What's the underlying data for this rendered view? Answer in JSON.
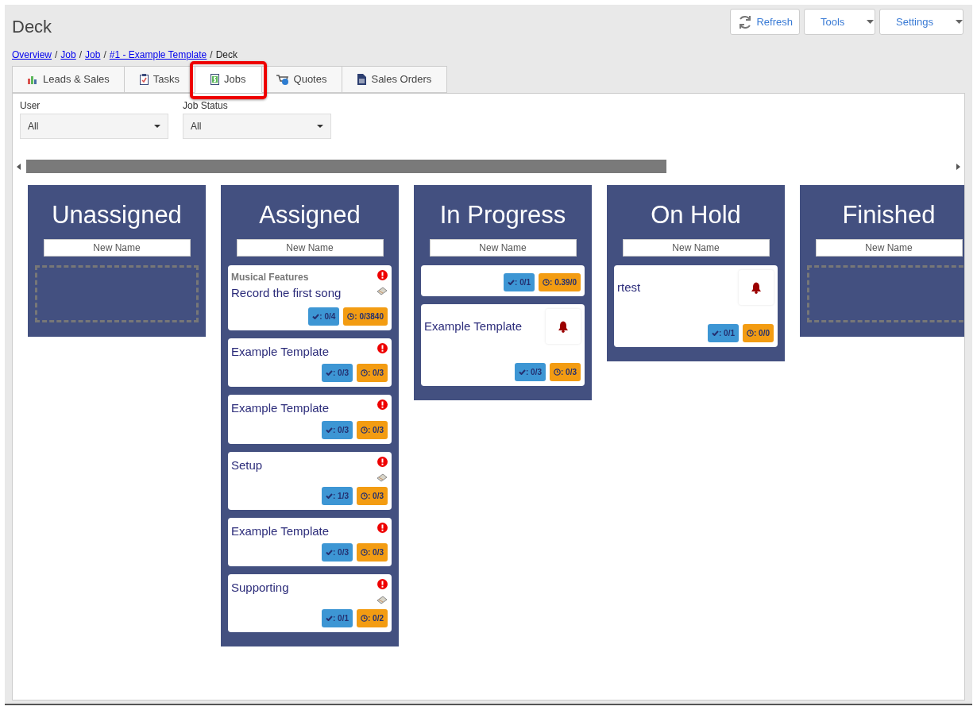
{
  "page_title": "Deck",
  "toolbar": [
    {
      "label": "Refresh",
      "kind": "refresh"
    },
    {
      "label": "Tools",
      "kind": "dropdown"
    },
    {
      "label": "Settings",
      "kind": "dropdown"
    }
  ],
  "breadcrumb": [
    {
      "label": "Overview",
      "kind": "link"
    },
    {
      "label": "/",
      "kind": "separator"
    },
    {
      "label": "Job",
      "kind": "link"
    },
    {
      "label": "/",
      "kind": "separator"
    },
    {
      "label": "Job",
      "kind": "link"
    },
    {
      "label": "/",
      "kind": "separator"
    },
    {
      "label": "#1 - Example Template",
      "kind": "link"
    },
    {
      "label": "/",
      "kind": "separator"
    },
    {
      "label": "Deck",
      "kind": "current"
    }
  ],
  "tabs": [
    {
      "label": "Leads & Sales",
      "selected": false,
      "highlighted": false
    },
    {
      "label": "Tasks",
      "selected": false,
      "highlighted": false
    },
    {
      "label": "Jobs",
      "selected": true,
      "highlighted": true
    },
    {
      "label": "Quotes",
      "selected": false,
      "highlighted": false
    },
    {
      "label": "Sales Orders",
      "selected": false,
      "highlighted": false
    }
  ],
  "filters": [
    {
      "label": "User",
      "value": "All"
    },
    {
      "label": "Job Status",
      "value": "All"
    }
  ],
  "columns": [
    {
      "title": "Unassigned",
      "placeholder": "New Name"
    },
    {
      "title": "Assigned",
      "placeholder": "New Name",
      "cards": [
        {
          "group": "Musical Features",
          "title": "Record the first song",
          "alert": true,
          "note": true,
          "bell": false,
          "tasks": ": 0/4",
          "time": ": 0/3840"
        },
        {
          "title": "Example Template",
          "alert": true,
          "note": false,
          "bell": false,
          "tasks": ": 0/3",
          "time": ": 0/3"
        },
        {
          "title": "Example Template",
          "alert": true,
          "note": false,
          "bell": false,
          "tasks": ": 0/3",
          "time": ": 0/3"
        },
        {
          "title": "Setup",
          "alert": true,
          "note": true,
          "bell": false,
          "tasks": ": 1/3",
          "time": ": 0/3"
        },
        {
          "title": "Example Template",
          "alert": true,
          "note": false,
          "bell": false,
          "tasks": ": 0/3",
          "time": ": 0/3"
        },
        {
          "title": "Supporting",
          "alert": true,
          "note": true,
          "bell": false,
          "tasks": ": 0/1",
          "time": ": 0/2"
        }
      ]
    },
    {
      "title": "In Progress",
      "placeholder": "New Name",
      "cards": [
        {
          "alert": false,
          "note": false,
          "bell": false,
          "tasks": ": 0/1",
          "time": ": 0.39/0"
        },
        {
          "title": "Example Template",
          "alert": false,
          "note": false,
          "bell": true,
          "tasks": ": 0/3",
          "time": ": 0/3"
        }
      ]
    },
    {
      "title": "On Hold",
      "placeholder": "New Name",
      "cards": [
        {
          "title": "rtest",
          "alert": false,
          "note": false,
          "bell": true,
          "tasks": ": 0/1",
          "time": ": 0/0"
        }
      ]
    },
    {
      "title": "Finished",
      "placeholder": "New Name"
    }
  ]
}
